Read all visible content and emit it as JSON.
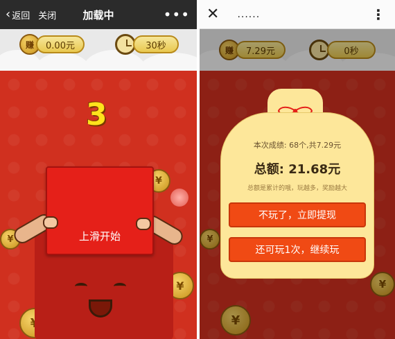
{
  "left_screen": {
    "topbar": {
      "back_label": "返回",
      "close_label": "关闭",
      "title": "加载中",
      "more_icon": "more-horizontal-icon"
    },
    "coins": {
      "amount": "0.00元"
    },
    "timer": {
      "value": "30秒"
    },
    "countdown": "3",
    "envelope": {
      "slide_text": "上滑开始"
    }
  },
  "right_screen": {
    "topbar": {
      "title": "......",
      "close_icon": "close-icon",
      "more_icon": "more-vertical-icon"
    },
    "coins": {
      "amount": "7.29元"
    },
    "timer": {
      "value": "0秒"
    },
    "result": {
      "score_text": "本次成绩: 68个,共7.29元",
      "total_text": "总额: 21.68元",
      "hint_text": "总额是累计的哦，玩越多，奖励越大",
      "withdraw_button": "不玩了，立即提现",
      "continue_button": "还可玩1次，继续玩"
    }
  },
  "colors": {
    "accent_red": "#d0301f",
    "button_orange": "#f04a14",
    "bag_yellow": "#fde79a",
    "countdown_yellow": "#ffe21c"
  }
}
